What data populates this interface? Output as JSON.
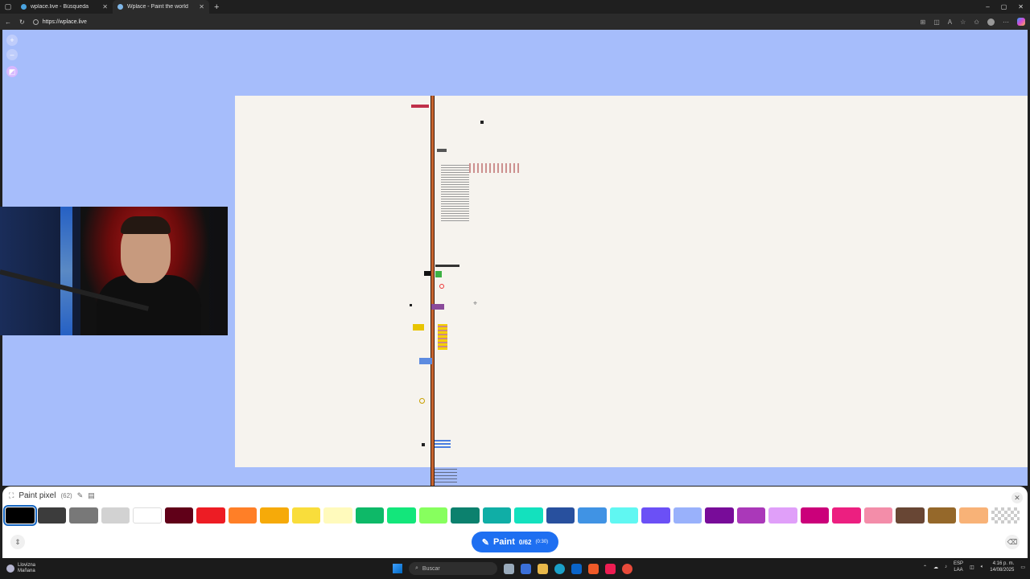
{
  "browser": {
    "tabs": [
      {
        "title": "wplace.live - Búsqueda",
        "active": false
      },
      {
        "title": "Wplace - Paint the world",
        "active": true
      }
    ],
    "url": "https://wplace.live"
  },
  "paint_panel": {
    "title": "Paint pixel",
    "count": "(62)",
    "palette": [
      "#000000",
      "#3c3c3c",
      "#787878",
      "#d2d2d2",
      "#ffffff",
      "#600018",
      "#ed1c24",
      "#ff7f27",
      "#f6aa09",
      "#f9dd3b",
      "#fffabc",
      "#0eb968",
      "#13e67b",
      "#87ff5e",
      "#0c816e",
      "#10aea6",
      "#13e1be",
      "#28509e",
      "#4093e4",
      "#60f7f2",
      "#6b50f6",
      "#99b1fb",
      "#780c99",
      "#aa38b9",
      "#e09ff9",
      "#cb007a",
      "#ec1f80",
      "#f38da9",
      "#684634",
      "#95682a",
      "#f8b277",
      "transparent"
    ],
    "selected_index": 0,
    "paint_button": {
      "label": "Paint",
      "progress": "0/62",
      "timer": "(0:30)"
    }
  },
  "colors": {
    "map_water": "#a6bdfb",
    "map_land": "#f6f3ee",
    "accent": "#1e6ff1"
  },
  "taskbar": {
    "weather_line1": "Llovizna",
    "weather_line2": "Mañana",
    "search_placeholder": "Buscar",
    "lang_line1": "ESP",
    "lang_line2": "LAA",
    "time": "4:16 p. m.",
    "date": "14/08/2025"
  }
}
